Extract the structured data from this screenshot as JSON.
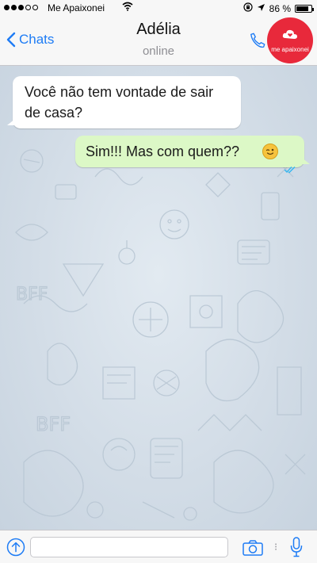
{
  "status_bar": {
    "carrier": "Me Apaixonei",
    "battery_text": "86 %",
    "battery_level": 0.86
  },
  "header": {
    "back_label": "Chats",
    "contact_name": "Adélia",
    "contact_status": "online",
    "avatar_text": "me apaixonei"
  },
  "messages": [
    {
      "direction": "incoming",
      "text": "Você não tem vontade de sair de casa?"
    },
    {
      "direction": "outgoing",
      "text": "Sim!!! Mas com quem??",
      "emoji": "winking-smiley-icon",
      "read_receipt": "double-check-icon"
    }
  ],
  "input_bar": {
    "value": "",
    "placeholder": ""
  },
  "colors": {
    "accent": "#1e7cf5",
    "avatar_background": "#e8293b",
    "outgoing_bubble": "#dcf8c6",
    "incoming_bubble": "#ffffff",
    "read_ticks": "#34b7f1"
  }
}
